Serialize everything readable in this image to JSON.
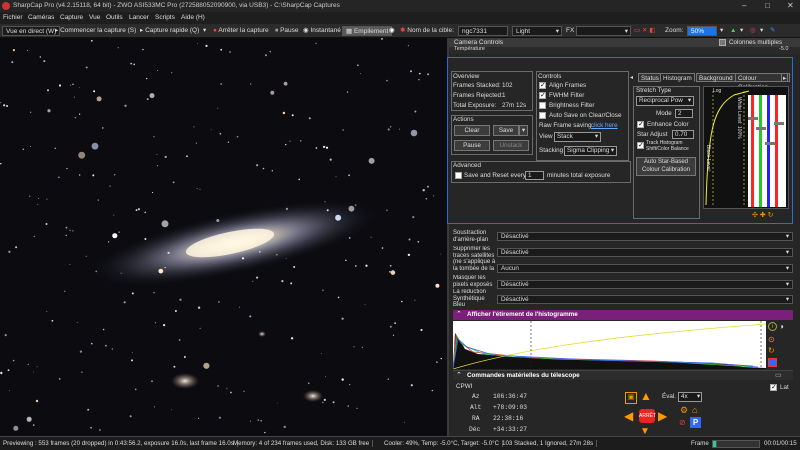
{
  "app": {
    "title": "SharpCap Pro (v4.2.15118, 64 bit) - ZWO ASI533MC Pro (272588052090900, via USB3) - C:\\SharpCap Captures"
  },
  "menu": [
    "Fichier",
    "Caméras",
    "Capture",
    "Vue",
    "Outils",
    "Lancer",
    "Scripts",
    "Aide (H)"
  ],
  "toolbar": {
    "live": "Vue en direct (W)",
    "start_capture": "Commencer la capture (S)",
    "quick_capture": "Capture rapide (Q)",
    "stop_capture": "Arrêter la capture",
    "pause": "Pause",
    "snapshot": "Instantané",
    "stack": "Empilement",
    "target_label": "Nom de la cible:",
    "target_value": "ngc7331",
    "profile": "Light",
    "fx": "FX",
    "zoom_label": "Zoom:",
    "zoom_value": "50%"
  },
  "panel": {
    "title": "Camera Controls",
    "multicol": "Colonnes multiples",
    "temp": "Température",
    "temp_value": "-5.0"
  },
  "overview": {
    "heading": "Overview",
    "stacked_label": "Frames Stacked:",
    "stacked": "102",
    "rejected_label": "Frames Rejected:",
    "rejected": "1",
    "exposure_label": "Total Exposure:",
    "exposure": "27m 12s"
  },
  "actions": {
    "heading": "Actions",
    "clear": "Clear",
    "save": "Save",
    "pause": "Pause",
    "unstack": "Unstack"
  },
  "advanced": {
    "heading": "Advanced",
    "save_reset": "Save and Reset every",
    "minutes": "1",
    "minutes_suffix": "minutes total exposure"
  },
  "controls": {
    "heading": "Controls",
    "align": "Align Frames",
    "fwhm": "FWHM Filter",
    "brightness": "Brightness Filter",
    "autosave": "Auto Save on Clear/Close",
    "raw_label": "Raw Frame saving",
    "raw_link": "click here",
    "view_label": "View",
    "view_value": "Stack",
    "stacking_label": "Stacking",
    "stacking_value": "Sigma Clipping"
  },
  "tabs": [
    "Status",
    "Histogram",
    "Background",
    "Colour Calibration"
  ],
  "stretch": {
    "heading": "Stretch Type",
    "type": "Reciprocal Pow",
    "mode_label": "Mode",
    "mode": "2",
    "enhance": "Enhance Color",
    "star_adjust_label": "Star Adjust",
    "star_adjust": "0.70",
    "track": "Track Histogram Shift/Color Balance",
    "auto_btn": "Auto Star-Based Colour Calibration",
    "log": "Log",
    "black": "Black Level:",
    "white": "White Level: 100%"
  },
  "settings": [
    {
      "label": "Soustraction d'arrière-plan",
      "value": "Désactivé"
    },
    {
      "label": "Supprimer les traces satellites (ne s'applique à la tombée de la nuit)",
      "value": "Désactivé"
    },
    {
      "label": "Masquer les pixels exposés",
      "value": "Aucun"
    },
    {
      "label": "La réduction Synthétique",
      "value": "Désactivé"
    },
    {
      "label": "Bleu",
      "value": "Désactivé"
    }
  ],
  "histogram": {
    "title": "Afficher l'étirement de l'histogramme"
  },
  "telescope": {
    "title": "Commandes matérielles du télescope",
    "mount": "CPWI",
    "lat": "Lat",
    "az_label": "Az",
    "az": "106:36:47",
    "alt_label": "Alt",
    "alt": "+78:09:03",
    "ra_label": "RA",
    "ra": "22:38:16",
    "dec_label": "Déc",
    "dec": "+34:33:27",
    "eval_label": "Éval.",
    "eval": "4x",
    "stop": "ARRÊT"
  },
  "status": {
    "preview": "Previewing : 553 frames (20 dropped) in 0:43:56.2, exposure 16.0s, last frame 16.0s",
    "memory": "Memory: 4 of 234 frames used, Disk: 133 GB free",
    "cooler": "Cooler: 49%, Temp: -5.0°C, Target: -5.0°C",
    "stacked": "103 Stacked, 1 Ignored, 27m 28s",
    "frame_label": "Frame",
    "time": "00:01/00:15"
  },
  "colors": {
    "accent": "#2b6cd8",
    "zoom_bg": "#1e73e8",
    "histo_header": "#7a1f7a",
    "stack_active": "#5a5a5a"
  }
}
